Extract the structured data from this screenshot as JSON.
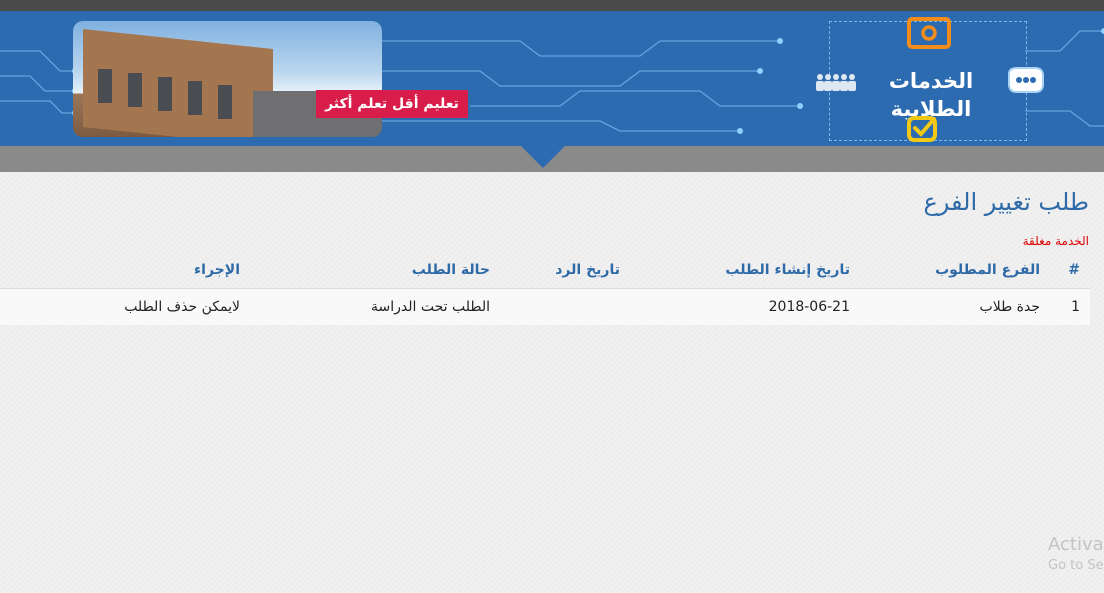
{
  "banner": {
    "slogan": "تعليم أقل تعلم أكثر",
    "brand_title": "الخدمات الطلابية",
    "colors": {
      "banner_bg": "#2d6bb0",
      "slogan_bg": "#d91d4a",
      "accent_orange": "#f28c1b",
      "accent_yellow": "#f3c815"
    },
    "icons": [
      "at-sign-icon",
      "chat-bubble-icon",
      "people-group-icon",
      "checkbox-icon"
    ]
  },
  "page": {
    "title": "طلب تغيير الفرع",
    "service_status": "الخدمة مغلقة"
  },
  "table": {
    "headers": {
      "num": "#",
      "branch": "الفرع المطلوب",
      "created": "تاريخ إنشاء الطلب",
      "reply_date": "تاريخ الرد",
      "status": "حالة الطلب",
      "action": "الإجراء"
    },
    "rows": [
      {
        "num": "1",
        "branch": "جدة طلاب",
        "created": "2018-06-21",
        "reply_date": "",
        "status": "الطلب تحت الدراسة",
        "action": "لايمكن حذف الطلب"
      }
    ]
  },
  "watermark": {
    "line1": "Activat",
    "line2": "Go to Se"
  }
}
